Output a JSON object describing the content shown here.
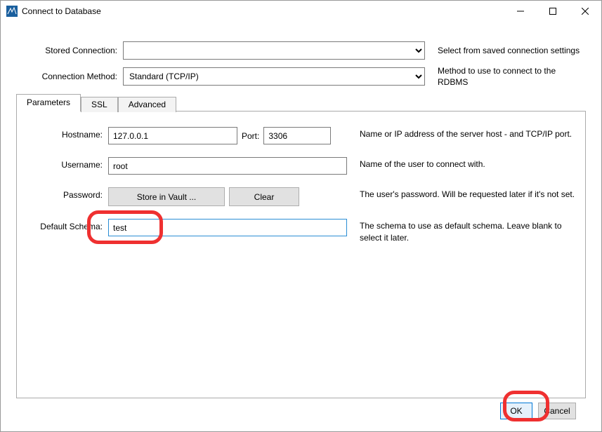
{
  "window": {
    "title": "Connect to Database"
  },
  "form": {
    "stored_connection": {
      "label": "Stored Connection:",
      "help": "Select from saved connection settings"
    },
    "connection_method": {
      "label": "Connection Method:",
      "selected": "Standard (TCP/IP)",
      "help": "Method to use to connect to the RDBMS"
    }
  },
  "tabs": {
    "parameters": "Parameters",
    "ssl": "SSL",
    "advanced": "Advanced"
  },
  "params": {
    "hostname": {
      "label": "Hostname:",
      "value": "127.0.0.1",
      "port_label": "Port:",
      "port_value": "3306",
      "help": "Name or IP address of the server host - and TCP/IP port."
    },
    "username": {
      "label": "Username:",
      "value": "root",
      "help": "Name of the user to connect with."
    },
    "password": {
      "label": "Password:",
      "store_label": "Store in Vault ...",
      "clear_label": "Clear",
      "help": "The user's password. Will be requested later if it's not set."
    },
    "default_schema": {
      "label": "Default Schema:",
      "value": "test",
      "help": "The schema to use as default schema. Leave blank to select it later."
    }
  },
  "buttons": {
    "ok": "OK",
    "cancel": "Cancel"
  }
}
